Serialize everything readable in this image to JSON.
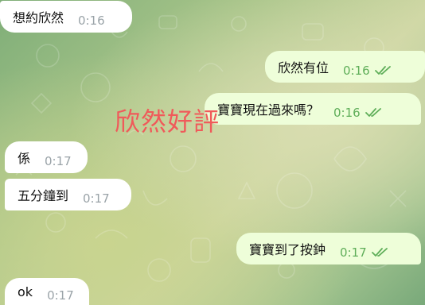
{
  "chat": {
    "messages": [
      {
        "text": "想約欣然",
        "time": "0:16",
        "direction": "incoming"
      },
      {
        "text": "欣然有位",
        "time": "0:16",
        "direction": "outgoing"
      },
      {
        "text": "寶寶現在過來嗎？",
        "time": "0:16",
        "direction": "outgoing"
      },
      {
        "text": "係",
        "time": "0:17",
        "direction": "incoming"
      },
      {
        "text": "五分鐘到",
        "time": "0:17",
        "direction": "incoming"
      },
      {
        "text": "寶寶到了按鈡",
        "time": "0:17",
        "direction": "outgoing"
      },
      {
        "text": "ok",
        "time": "0:17",
        "direction": "incoming"
      }
    ]
  },
  "overlay": {
    "text": "欣然好評",
    "color": "#f05a5a"
  },
  "colors": {
    "incoming_bubble": "#ffffff",
    "outgoing_bubble": "#eefed9",
    "read_check": "#5fae59"
  },
  "icons": {
    "read_receipt": "double-check-icon"
  }
}
